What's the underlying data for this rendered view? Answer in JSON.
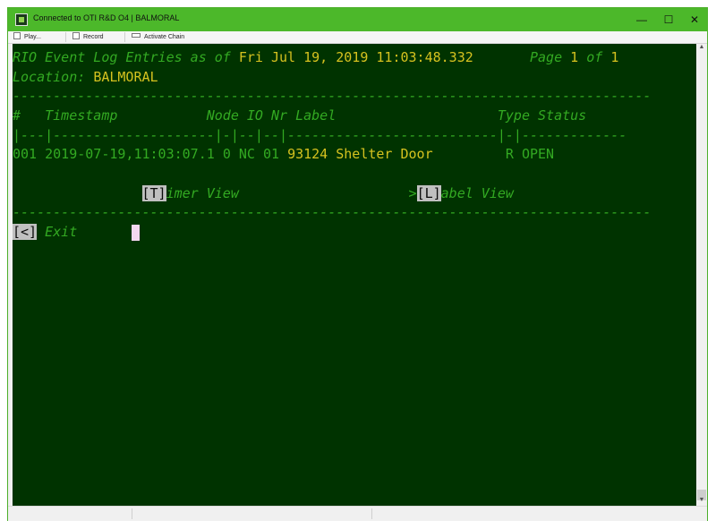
{
  "window": {
    "title": "Connected to OTI R&D O4 | BALMORAL",
    "controls": {
      "minimize": "—",
      "maximize": "☐",
      "close": "✕"
    }
  },
  "toolbar": {
    "play_label": "Play...",
    "record_label": "Record",
    "chain_label": "Activate Chain"
  },
  "terminal": {
    "header_prefix": "RIO Event Log Entries as of ",
    "header_datetime": "Fri Jul 19, 2019 11:03:48.332",
    "page_word": "Page ",
    "page_current": "1",
    "page_of": " of ",
    "page_total": "1",
    "location_label": "Location: ",
    "location_value": "BALMORAL",
    "rule_dashes": "-------------------------------------------------------------------------------",
    "columns": {
      "num": "#",
      "timestamp": "Timestamp",
      "node": "Node",
      "io": "IO",
      "nr": "Nr",
      "label": "Label",
      "type": "Type",
      "status": "Status"
    },
    "column_rule": "|---|--------------------|-|--|--|--------------------------|-|-------------",
    "rows": [
      {
        "num": "001",
        "timestamp": "2019-07-19,11:03:07.1",
        "node": "0",
        "io": "NC",
        "nr": "01",
        "label": "93124 Shelter Door",
        "type": "R",
        "status": "OPEN"
      }
    ],
    "timer_key": "[T]",
    "timer_rest": "imer View",
    "label_marker": ">",
    "label_key": "[L]",
    "label_rest": "abel View",
    "exit_key": "[<]",
    "exit_label": " Exit"
  },
  "colors": {
    "terminal_bg": "#003300",
    "text_green": "#33aa22",
    "text_yellow": "#d6c21f",
    "key_bg": "#c0c0c0",
    "cursor": "#f4d7f0",
    "titlebar": "#4cb82a"
  }
}
